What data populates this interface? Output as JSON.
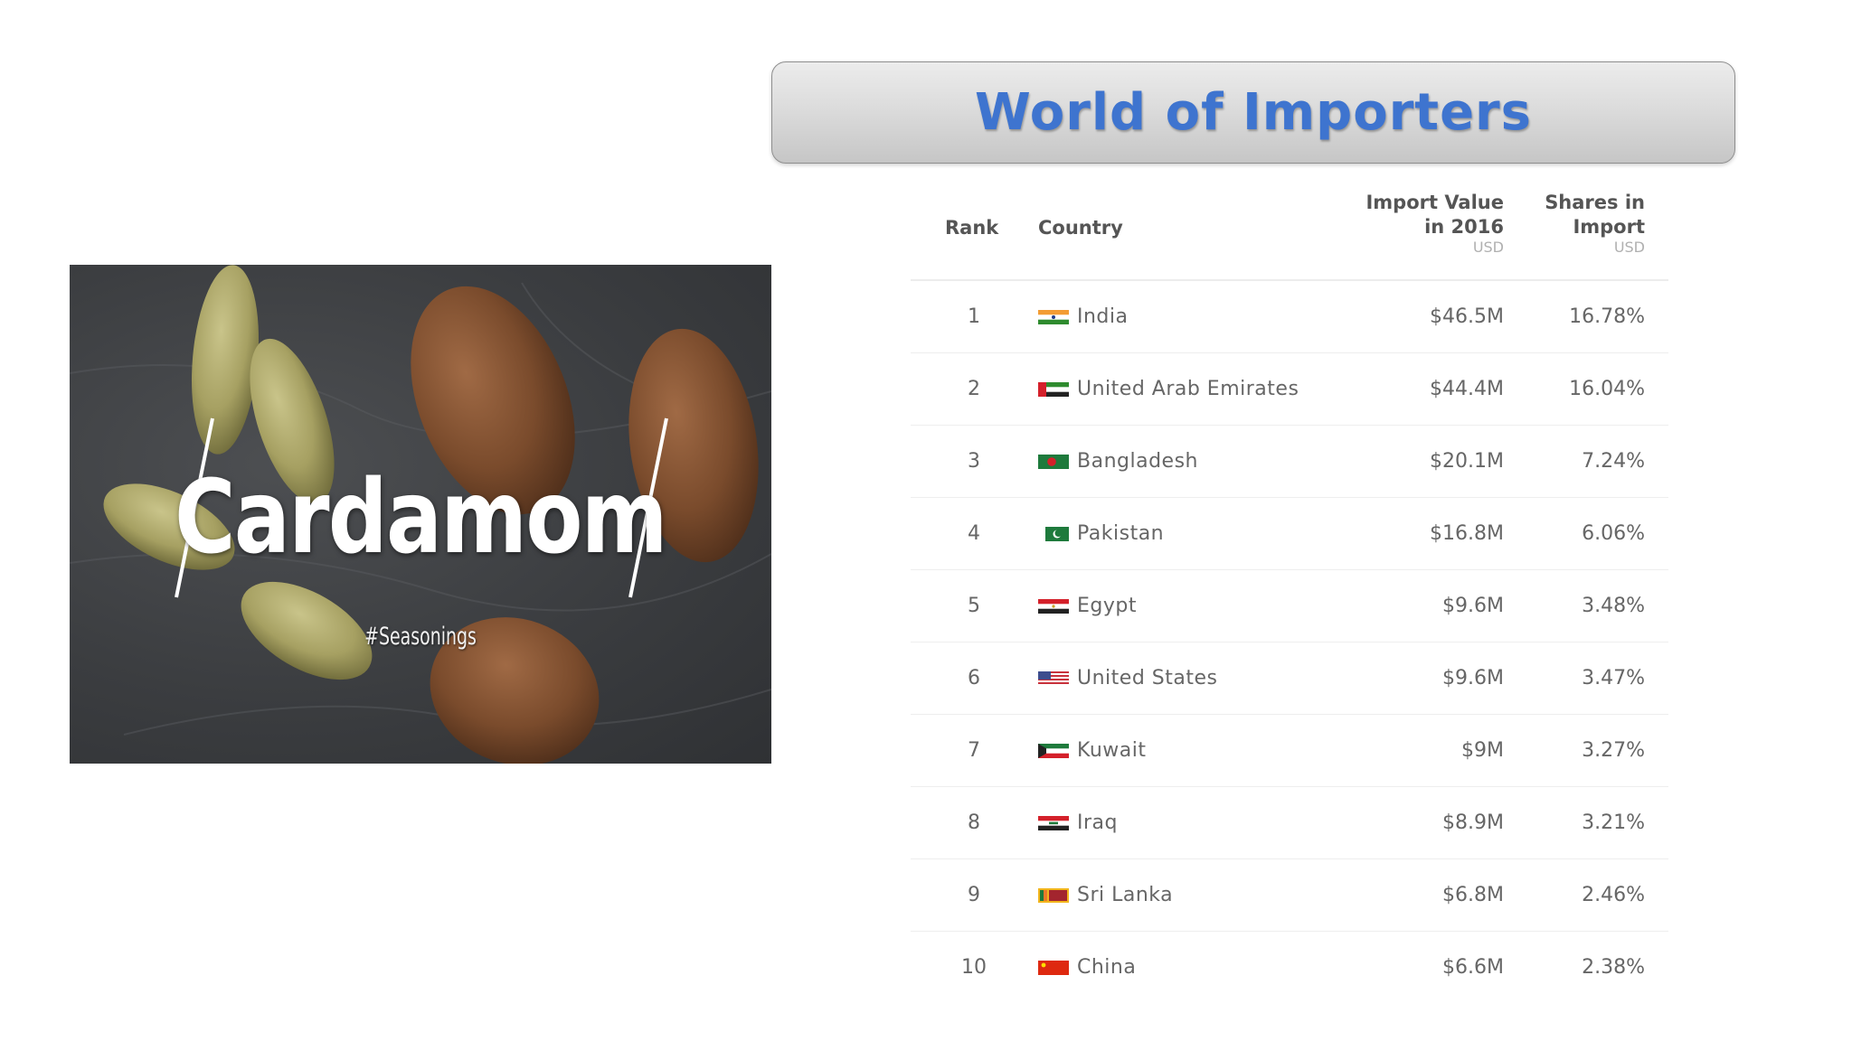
{
  "title": "World of Importers",
  "image": {
    "title": "Cardamom",
    "tag": "#Seasonings"
  },
  "table": {
    "headers": {
      "rank": "Rank",
      "country": "Country",
      "value_line1": "Import Value",
      "value_line2": "in 2016",
      "value_unit": "USD",
      "share_line1": "Shares in",
      "share_line2": "Import",
      "share_unit": "USD"
    },
    "rows": [
      {
        "rank": "1",
        "country": "India",
        "value": "$46.5M",
        "share": "16.78%",
        "flag": "india-flag-icon"
      },
      {
        "rank": "2",
        "country": "United Arab Emirates",
        "value": "$44.4M",
        "share": "16.04%",
        "flag": "uae-flag-icon"
      },
      {
        "rank": "3",
        "country": "Bangladesh",
        "value": "$20.1M",
        "share": "7.24%",
        "flag": "bangladesh-flag-icon"
      },
      {
        "rank": "4",
        "country": "Pakistan",
        "value": "$16.8M",
        "share": "6.06%",
        "flag": "pakistan-flag-icon"
      },
      {
        "rank": "5",
        "country": "Egypt",
        "value": "$9.6M",
        "share": "3.48%",
        "flag": "egypt-flag-icon"
      },
      {
        "rank": "6",
        "country": "United States",
        "value": "$9.6M",
        "share": "3.47%",
        "flag": "usa-flag-icon"
      },
      {
        "rank": "7",
        "country": "Kuwait",
        "value": "$9M",
        "share": "3.27%",
        "flag": "kuwait-flag-icon"
      },
      {
        "rank": "8",
        "country": "Iraq",
        "value": "$8.9M",
        "share": "3.21%",
        "flag": "iraq-flag-icon"
      },
      {
        "rank": "9",
        "country": "Sri Lanka",
        "value": "$6.8M",
        "share": "2.46%",
        "flag": "sri-lanka-flag-icon"
      },
      {
        "rank": "10",
        "country": "China",
        "value": "$6.6M",
        "share": "2.38%",
        "flag": "china-flag-icon"
      }
    ]
  },
  "colors": {
    "title_text": "#3e74cf",
    "header_text": "#555555",
    "cell_text": "#666666",
    "unit_text": "#b0b0b0"
  }
}
